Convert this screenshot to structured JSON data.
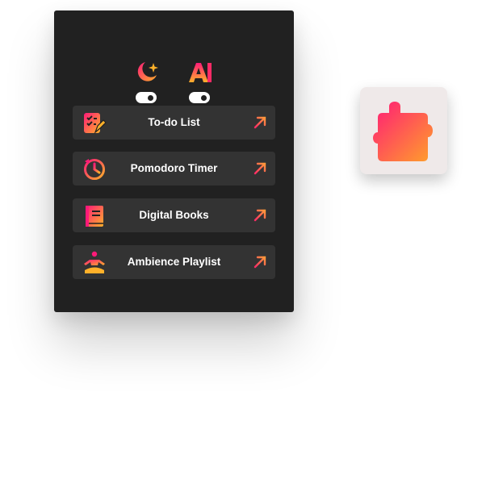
{
  "colors": {
    "panel_bg": "#212121",
    "item_bg": "#333333",
    "gradient_start": "#ff1a78",
    "gradient_end": "#ffb12a",
    "tile_bg": "#efe9e9"
  },
  "header": {
    "moon_toggle": {
      "icon": "moon-star-icon",
      "on": true
    },
    "font_toggle": {
      "icon": "font-a-icon",
      "on": true
    }
  },
  "menu": {
    "items": [
      {
        "label": "To-do List",
        "icon": "checklist-icon"
      },
      {
        "label": "Pomodoro Timer",
        "icon": "timer-icon"
      },
      {
        "label": "Digital Books",
        "icon": "book-icon"
      },
      {
        "label": "Ambience Playlist",
        "icon": "meditation-icon"
      }
    ]
  },
  "extension_tile": {
    "icon": "puzzle-piece-icon"
  }
}
